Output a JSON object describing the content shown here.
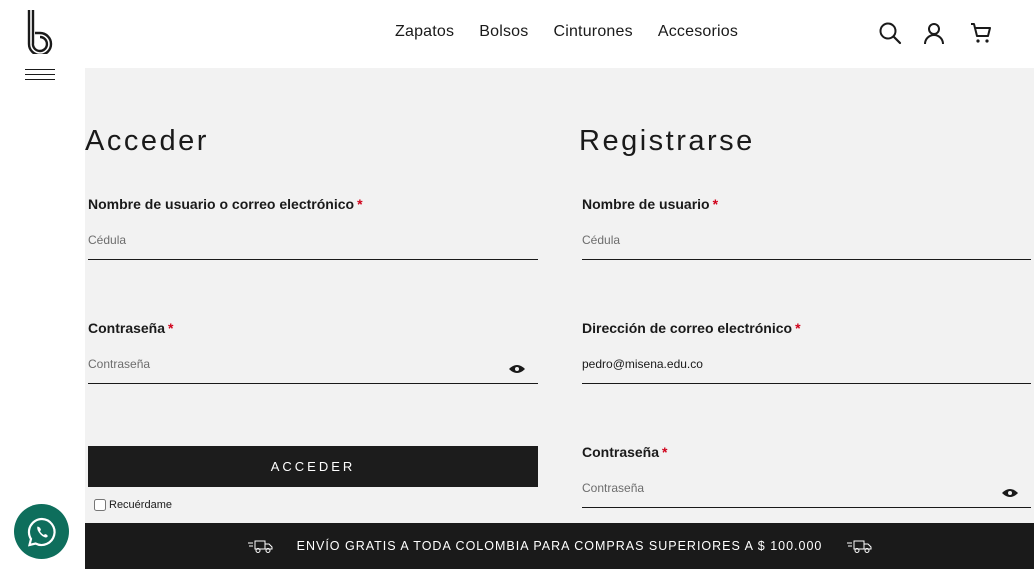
{
  "header": {
    "logo_letter": "b",
    "nav": [
      "Zapatos",
      "Bolsos",
      "Cinturones",
      "Accesorios"
    ],
    "icons": [
      "search-icon",
      "user-icon",
      "cart-icon"
    ]
  },
  "login": {
    "title": "Acceder",
    "username_label": "Nombre de usuario o correo electrónico",
    "username_placeholder": "Cédula",
    "username_value": "",
    "password_label": "Contraseña",
    "password_placeholder": "Contraseña",
    "password_value": "",
    "required_mark": "*",
    "button_label": "ACCEDER",
    "remember_label": "Recuérdame",
    "remember_checked": false
  },
  "register": {
    "title": "Registrarse",
    "username_label": "Nombre de usuario",
    "username_placeholder": "Cédula",
    "username_value": "",
    "email_label": "Dirección de correo electrónico",
    "email_value": "pedro@misena.edu.co",
    "password_label": "Contraseña",
    "password_placeholder": "Contraseña",
    "password_value": "",
    "required_mark": "*"
  },
  "banner": {
    "text": "ENVÍO GRATIS A TODA COLOMBIA PARA COMPRAS SUPERIORES A $ 100.000",
    "icon": "delivery-truck-icon"
  },
  "colors": {
    "dark": "#1a1a1a",
    "panel_bg": "#f2f2f2",
    "required": "#d0021b",
    "whatsapp": "#0e6e5c"
  }
}
